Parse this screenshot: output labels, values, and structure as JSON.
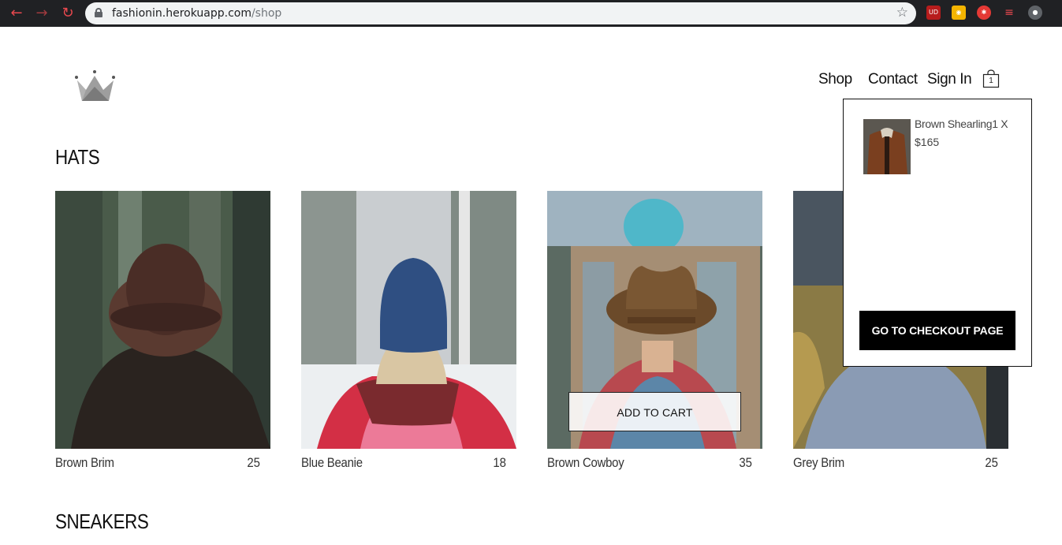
{
  "browser": {
    "url_host": "fashionin.herokuapp.com",
    "url_path": "/shop"
  },
  "nav": {
    "shop": "Shop",
    "contact": "Contact",
    "sign_in": "Sign In",
    "cart_count": "1"
  },
  "sections": {
    "hats_title": "HATS",
    "sneakers_title": "SNEAKERS"
  },
  "products": [
    {
      "name": "Brown Brim",
      "price": "25"
    },
    {
      "name": "Blue Beanie",
      "price": "18"
    },
    {
      "name": "Brown Cowboy",
      "price": "35"
    },
    {
      "name": "Grey Brim",
      "price": "25"
    }
  ],
  "add_to_cart_label": "ADD TO CART",
  "cart": {
    "item_name": "Brown Shearling1 X",
    "item_price": "$165",
    "checkout_label": "GO TO CHECKOUT PAGE"
  },
  "colors": {
    "chrome": "#202124",
    "checkout_bg": "#000000"
  }
}
